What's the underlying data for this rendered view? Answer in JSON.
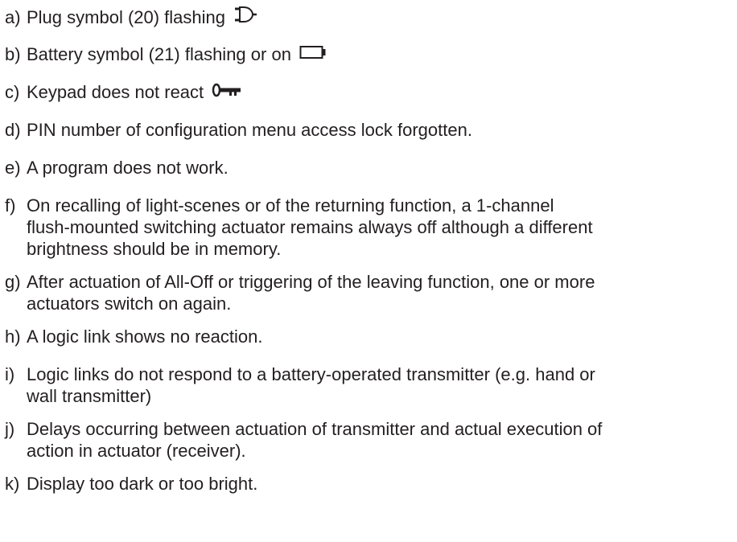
{
  "items": [
    {
      "letter": "a)",
      "lines": [
        "Plug symbol (20) flashing"
      ],
      "icon": "plug-icon"
    },
    {
      "letter": "b)",
      "lines": [
        "Battery symbol (21) flashing or on"
      ],
      "icon": "battery-icon"
    },
    {
      "letter": "c)",
      "lines": [
        "Keypad does not react"
      ],
      "icon": "key-icon"
    },
    {
      "letter": "d)",
      "lines": [
        "PIN number of configuration menu access lock forgotten."
      ]
    },
    {
      "letter": "e)",
      "lines": [
        "A program does not work."
      ]
    },
    {
      "letter": "f)",
      "lines": [
        "On recalling of light-scenes or of the returning function, a 1-channel",
        "flush-mounted switching actuator remains always off although a different",
        "brightness should be in memory."
      ]
    },
    {
      "letter": "g)",
      "lines": [
        "After actuation of All-Off or triggering of the leaving function, one or more",
        "actuators switch on again."
      ]
    },
    {
      "letter": "h)",
      "lines": [
        "A logic link shows no reaction."
      ]
    },
    {
      "letter": "i)",
      "lines": [
        "Logic links do not respond to a battery-operated transmitter (e.g. hand or",
        "wall transmitter)"
      ]
    },
    {
      "letter": "j)",
      "lines": [
        "Delays occurring between actuation of transmitter and actual execution of",
        "action in actuator (receiver)."
      ]
    },
    {
      "letter": "k)",
      "lines": [
        "Display too dark or too bright."
      ]
    }
  ]
}
